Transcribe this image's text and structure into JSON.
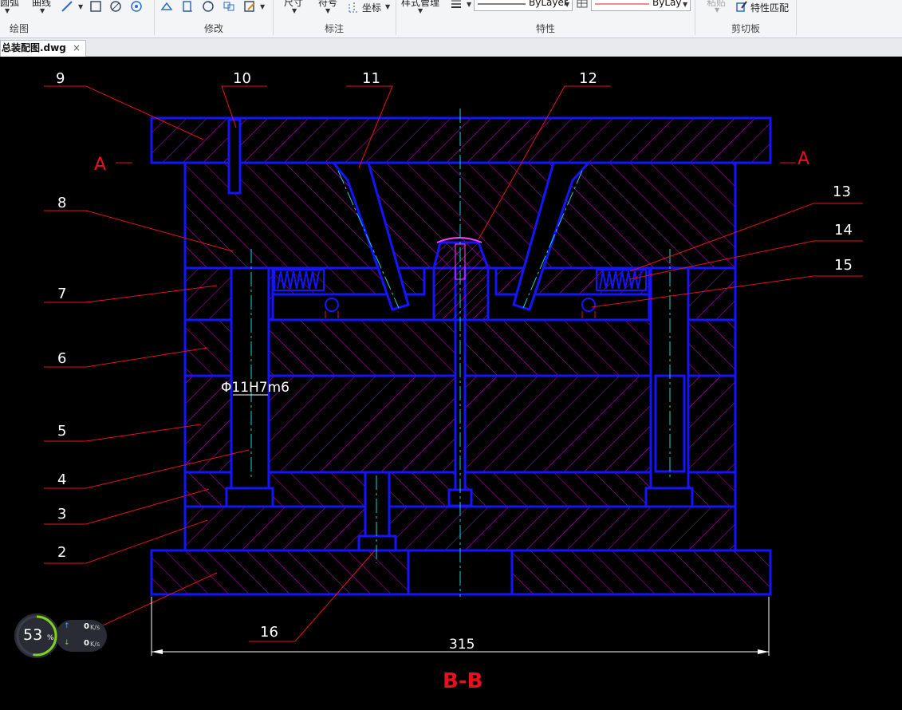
{
  "ribbon": {
    "draw_tools": {
      "arc_label": "圆弧",
      "curve_label": "曲线"
    },
    "annotate_tools": {
      "dimension_label": "尺寸",
      "symbol_label": "符号",
      "coordinate_label": "坐标"
    },
    "properties": {
      "style_manager_label": "样式管理",
      "linetype_value": "ByLayer",
      "color_value": "ByLay",
      "linetype_color": "#000000",
      "color_line_color": "#e8101e"
    },
    "clipboard": {
      "paste_label": "粘贴",
      "match_properties_label": "特性匹配"
    },
    "groups": {
      "draw": "绘图",
      "modify": "修改",
      "annotate": "标注",
      "properties": "特性",
      "clipboard": "剪切板"
    }
  },
  "document_tab": {
    "filename": "总装配图.dwg",
    "close_symbol": "×"
  },
  "drawing": {
    "callouts": [
      "9",
      "10",
      "11",
      "12",
      "8",
      "13",
      "14",
      "15",
      "7",
      "6",
      "5",
      "4",
      "3",
      "2",
      "16"
    ],
    "section_marks": {
      "left": "A",
      "right": "A"
    },
    "fit_annotation": "Φ11H7m6",
    "overall_width_dim": "315",
    "section_title": "B-B",
    "colors": {
      "outline": "#1414ff",
      "hatch": "#d400d4",
      "leader": "#e8101e",
      "centerline": "#1ad2d2",
      "label": "#ffffff",
      "title": "#e8101e",
      "background": "#000000"
    }
  },
  "net_widget": {
    "cpu_percent": 53,
    "percent_sign": "%",
    "upload_value": "0",
    "download_value": "0",
    "rate_unit": "K/s"
  }
}
